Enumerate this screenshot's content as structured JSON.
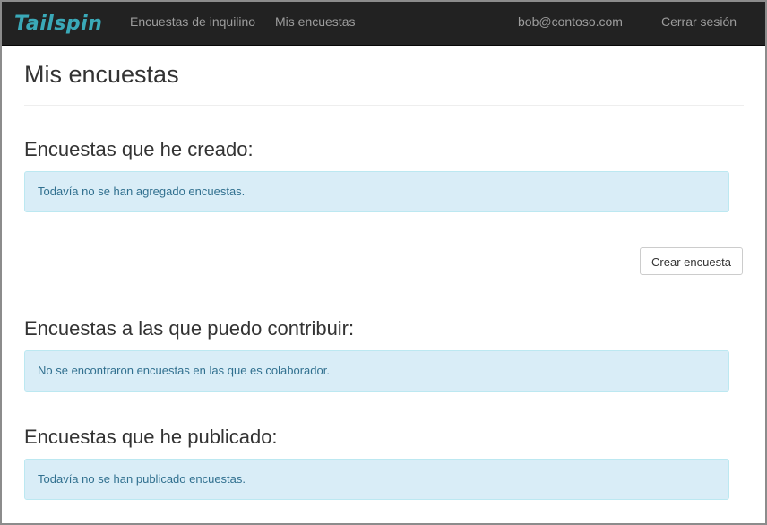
{
  "navbar": {
    "brand": "Tailspin",
    "links": {
      "tenant_surveys": "Encuestas de inquilino",
      "my_surveys": "Mis encuestas"
    },
    "user_email": "bob@contoso.com",
    "logout": "Cerrar sesión"
  },
  "page": {
    "title": "Mis encuestas"
  },
  "sections": {
    "created": {
      "heading": "Encuestas que he creado:",
      "message": "Todavía no se han agregado encuestas."
    },
    "create_button": "Crear encuesta",
    "contribute": {
      "heading": "Encuestas a las que puedo contribuir:",
      "message": "No se encontraron encuestas en las que es colaborador."
    },
    "published": {
      "heading": "Encuestas que he publicado:",
      "message": "Todavía no se han publicado encuestas."
    }
  },
  "colors": {
    "navbar_bg": "#222222",
    "brand": "#3aa9b8",
    "alert_bg": "#d9edf7",
    "alert_text": "#31708f"
  }
}
